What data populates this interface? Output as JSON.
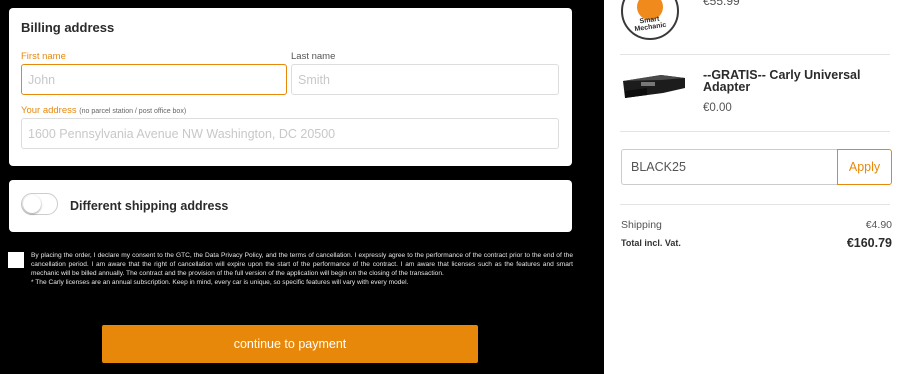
{
  "billing": {
    "title": "Billing address",
    "first_name_label": "First name",
    "first_name_placeholder": "John",
    "last_name_label": "Last name",
    "last_name_placeholder": "Smith",
    "address_label": "Your address",
    "address_hint": "(no parcel station / post office box)",
    "address_placeholder": "1600 Pennsylvania Avenue NW Washington, DC 20500"
  },
  "shipping_toggle": {
    "label": "Different shipping address",
    "checked": false
  },
  "consent": {
    "text": "By placing the order, I declare my consent to the GTC, the Data Privacy Policy, and the terms of cancellation. I expressly agree to the performance of the contract prior to the end of the cancellation period. I am aware that the right of cancellation will expire upon the start of the performance of the contract. I am aware that licenses such as the features and smart mechanic will be billed annually. The contract and the provision of the full version of the application will begin on the closing of the transaction.",
    "note": "* The Carly licenses are an annual subscription. Keep in mind, every car is unique, so specific features will vary with every model.",
    "checked": false
  },
  "pay_button": "continue to payment",
  "order": {
    "items": [
      {
        "logo_text": "Smart Mechanic",
        "price": "€55.99"
      },
      {
        "title": "--GRATIS-- Carly Universal Adapter",
        "price": "€0.00"
      }
    ],
    "coupon_value": "BLACK25",
    "apply_label": "Apply",
    "shipping_label": "Shipping",
    "shipping_value": "€4.90",
    "total_label": "Total incl. Vat.",
    "total_value": "€160.79"
  },
  "colors": {
    "accent": "#e8880b",
    "background": "#000000"
  }
}
